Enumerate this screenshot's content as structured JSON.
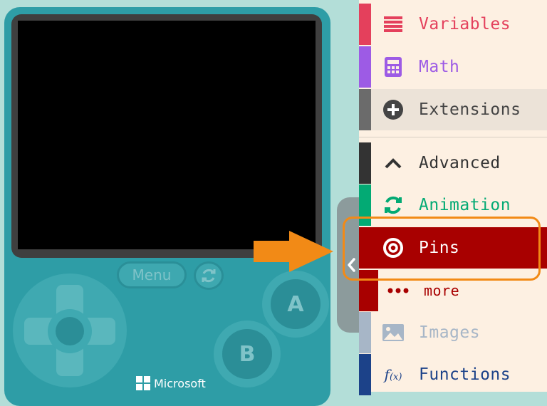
{
  "simulator": {
    "menu_label": "Menu",
    "button_a_label": "A",
    "button_b_label": "B",
    "brand_label": "Microsoft"
  },
  "toolbox": {
    "categories": [
      {
        "label": "Variables",
        "color": "#e4405c",
        "icon": "list-lines-icon"
      },
      {
        "label": "Math",
        "color": "#9d5be5",
        "icon": "calculator-icon"
      },
      {
        "label": "Extensions",
        "color": "#5e5e5e",
        "icon": "plus-circle-icon"
      },
      {
        "label": "Advanced",
        "color": "#333333",
        "icon": "chevron-up-icon"
      },
      {
        "label": "Animation",
        "color": "#03aa74",
        "icon": "refresh-icon"
      },
      {
        "label": "Pins",
        "color": "#a80000",
        "icon": "target-icon",
        "selected": true
      },
      {
        "label": "more",
        "color": "#a80000",
        "icon": "dots-icon"
      },
      {
        "label": "Images",
        "color": "#a7b6c7",
        "icon": "image-icon"
      },
      {
        "label": "Functions",
        "color": "#1c4289",
        "icon": "function-icon"
      }
    ]
  },
  "colors": {
    "device": "#2e9da6",
    "toolbox_bg": "#fdf0e2",
    "highlight": "#f28a16"
  }
}
